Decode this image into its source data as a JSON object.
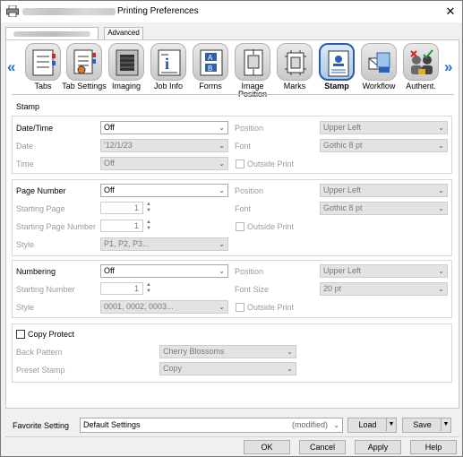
{
  "window": {
    "title": "Printing Preferences",
    "close_glyph": "✕"
  },
  "tabs": {
    "advanced_label": "Advanced"
  },
  "nav": {
    "prev_glyph": "«",
    "next_glyph": "»",
    "items": [
      {
        "label": "Tabs",
        "icon": "tabs-icon"
      },
      {
        "label": "Tab Settings",
        "icon": "tab-settings-icon"
      },
      {
        "label": "Imaging",
        "icon": "imaging-icon"
      },
      {
        "label": "Job Info",
        "icon": "job-info-icon"
      },
      {
        "label": "Forms",
        "icon": "forms-icon"
      },
      {
        "label": "Image Position",
        "icon": "image-position-icon"
      },
      {
        "label": "Marks",
        "icon": "marks-icon"
      },
      {
        "label": "Stamp",
        "icon": "stamp-icon",
        "selected": true
      },
      {
        "label": "Workflow",
        "icon": "workflow-icon"
      },
      {
        "label": "Authent.",
        "icon": "authentication-icon"
      }
    ]
  },
  "stamp": {
    "section_title": "Stamp",
    "datetime": {
      "label": "Date/Time",
      "value": "Off",
      "date_label": "Date",
      "date_value": "'12/1/23",
      "time_label": "Time",
      "time_value": "Off",
      "position_label": "Position",
      "position_value": "Upper Left",
      "font_label": "Font",
      "font_value": "Gothic 8 pt",
      "outside_print_label": "Outside Print"
    },
    "page_number": {
      "label": "Page Number",
      "value": "Off",
      "starting_page_label": "Starting Page",
      "starting_page_value": "1",
      "starting_page_number_label": "Starting Page Number",
      "starting_page_number_value": "1",
      "style_label": "Style",
      "style_value": "P1, P2, P3...",
      "position_label": "Position",
      "position_value": "Upper Left",
      "font_label": "Font",
      "font_value": "Gothic 8 pt",
      "outside_print_label": "Outside Print"
    },
    "numbering": {
      "label": "Numbering",
      "value": "Off",
      "starting_number_label": "Starting Number",
      "starting_number_value": "1",
      "style_label": "Style",
      "style_value": "0001, 0002, 0003...",
      "position_label": "Position",
      "position_value": "Upper Left",
      "font_size_label": "Font Size",
      "font_size_value": "20 pt",
      "outside_print_label": "Outside Print"
    },
    "copy_protect": {
      "label": "Copy Protect",
      "back_pattern_label": "Back Pattern",
      "back_pattern_value": "Cherry Blossoms",
      "preset_stamp_label": "Preset Stamp",
      "preset_stamp_value": "Copy"
    }
  },
  "favorite": {
    "label": "Favorite Setting",
    "value": "Default Settings",
    "modified": "(modified)",
    "load_label": "Load",
    "save_label": "Save"
  },
  "footer": {
    "ok_label": "OK",
    "cancel_label": "Cancel",
    "apply_label": "Apply",
    "help_label": "Help"
  },
  "glyphs": {
    "chevron": "⌄",
    "spin_up": "▲",
    "spin_down": "▼",
    "split_arrow": "▼"
  }
}
